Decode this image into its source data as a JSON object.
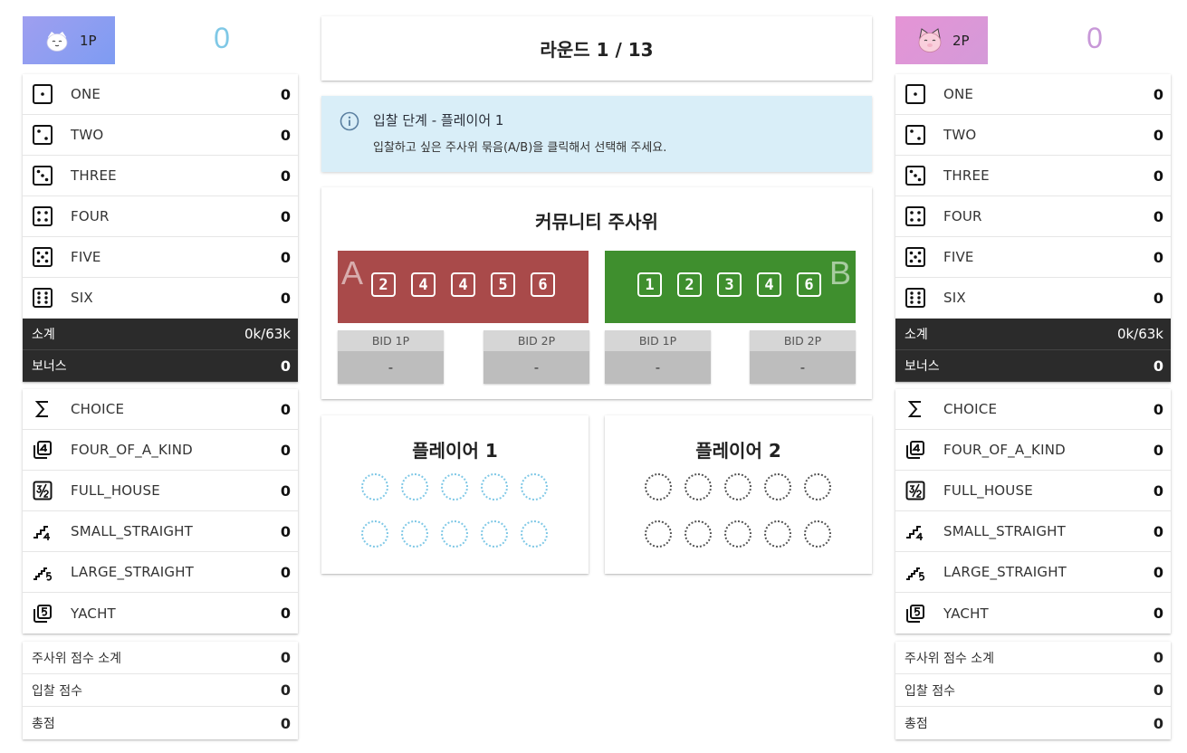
{
  "round": {
    "text": "라운드 1 / 13"
  },
  "info": {
    "title": "입찰 단계 - 플레이어 1",
    "description": "입찰하고 싶은 주사위 묶음(A/B)을 클릭해서 선택해 주세요."
  },
  "community": {
    "title": "커뮤니티 주사위",
    "bundles": [
      {
        "letter": "A",
        "color": "#a94a4a",
        "dice": [
          "2",
          "4",
          "4",
          "5",
          "6"
        ],
        "bids": [
          {
            "label": "BID 1P",
            "value": "-"
          },
          {
            "label": "BID 2P",
            "value": "-"
          }
        ]
      },
      {
        "letter": "B",
        "color": "#3f8f2e",
        "dice": [
          "1",
          "2",
          "3",
          "4",
          "6"
        ],
        "bids": [
          {
            "label": "BID 1P",
            "value": "-"
          },
          {
            "label": "BID 2P",
            "value": "-"
          }
        ]
      }
    ]
  },
  "panels": [
    {
      "title": "플레이어 1"
    },
    {
      "title": "플레이어 2"
    }
  ],
  "players": [
    {
      "tag": "1P",
      "score": "0",
      "accent": "#7fc8e6",
      "upper": [
        {
          "label": "ONE",
          "value": "0",
          "icon": "dice-one-icon"
        },
        {
          "label": "TWO",
          "value": "0",
          "icon": "dice-two-icon"
        },
        {
          "label": "THREE",
          "value": "0",
          "icon": "dice-three-icon"
        },
        {
          "label": "FOUR",
          "value": "0",
          "icon": "dice-four-icon"
        },
        {
          "label": "FIVE",
          "value": "0",
          "icon": "dice-five-icon"
        },
        {
          "label": "SIX",
          "value": "0",
          "icon": "dice-six-icon"
        }
      ],
      "subtotal": {
        "label": "소계",
        "value": "0k/63k"
      },
      "bonus": {
        "label": "보너스",
        "value": "0"
      },
      "lower": [
        {
          "label": "CHOICE",
          "value": "0",
          "icon": "sigma-icon"
        },
        {
          "label": "FOUR_OF_A_KIND",
          "value": "0",
          "icon": "four-of-a-kind-icon"
        },
        {
          "label": "FULL_HOUSE",
          "value": "0",
          "icon": "full-house-icon"
        },
        {
          "label": "SMALL_STRAIGHT",
          "value": "0",
          "icon": "small-straight-icon"
        },
        {
          "label": "LARGE_STRAIGHT",
          "value": "0",
          "icon": "large-straight-icon"
        },
        {
          "label": "YACHT",
          "value": "0",
          "icon": "yacht-icon"
        }
      ],
      "summary": [
        {
          "label": "주사위 점수 소계",
          "value": "0"
        },
        {
          "label": "입찰 점수",
          "value": "0"
        },
        {
          "label": "총점",
          "value": "0"
        }
      ]
    },
    {
      "tag": "2P",
      "score": "0",
      "accent": "#c898d8",
      "upper": [
        {
          "label": "ONE",
          "value": "0",
          "icon": "dice-one-icon"
        },
        {
          "label": "TWO",
          "value": "0",
          "icon": "dice-two-icon"
        },
        {
          "label": "THREE",
          "value": "0",
          "icon": "dice-three-icon"
        },
        {
          "label": "FOUR",
          "value": "0",
          "icon": "dice-four-icon"
        },
        {
          "label": "FIVE",
          "value": "0",
          "icon": "dice-five-icon"
        },
        {
          "label": "SIX",
          "value": "0",
          "icon": "dice-six-icon"
        }
      ],
      "subtotal": {
        "label": "소계",
        "value": "0k/63k"
      },
      "bonus": {
        "label": "보너스",
        "value": "0"
      },
      "lower": [
        {
          "label": "CHOICE",
          "value": "0",
          "icon": "sigma-icon"
        },
        {
          "label": "FOUR_OF_A_KIND",
          "value": "0",
          "icon": "four-of-a-kind-icon"
        },
        {
          "label": "FULL_HOUSE",
          "value": "0",
          "icon": "full-house-icon"
        },
        {
          "label": "SMALL_STRAIGHT",
          "value": "0",
          "icon": "small-straight-icon"
        },
        {
          "label": "LARGE_STRAIGHT",
          "value": "0",
          "icon": "large-straight-icon"
        },
        {
          "label": "YACHT",
          "value": "0",
          "icon": "yacht-icon"
        }
      ],
      "summary": [
        {
          "label": "주사위 점수 소계",
          "value": "0"
        },
        {
          "label": "입찰 점수",
          "value": "0"
        },
        {
          "label": "총점",
          "value": "0"
        }
      ]
    }
  ]
}
